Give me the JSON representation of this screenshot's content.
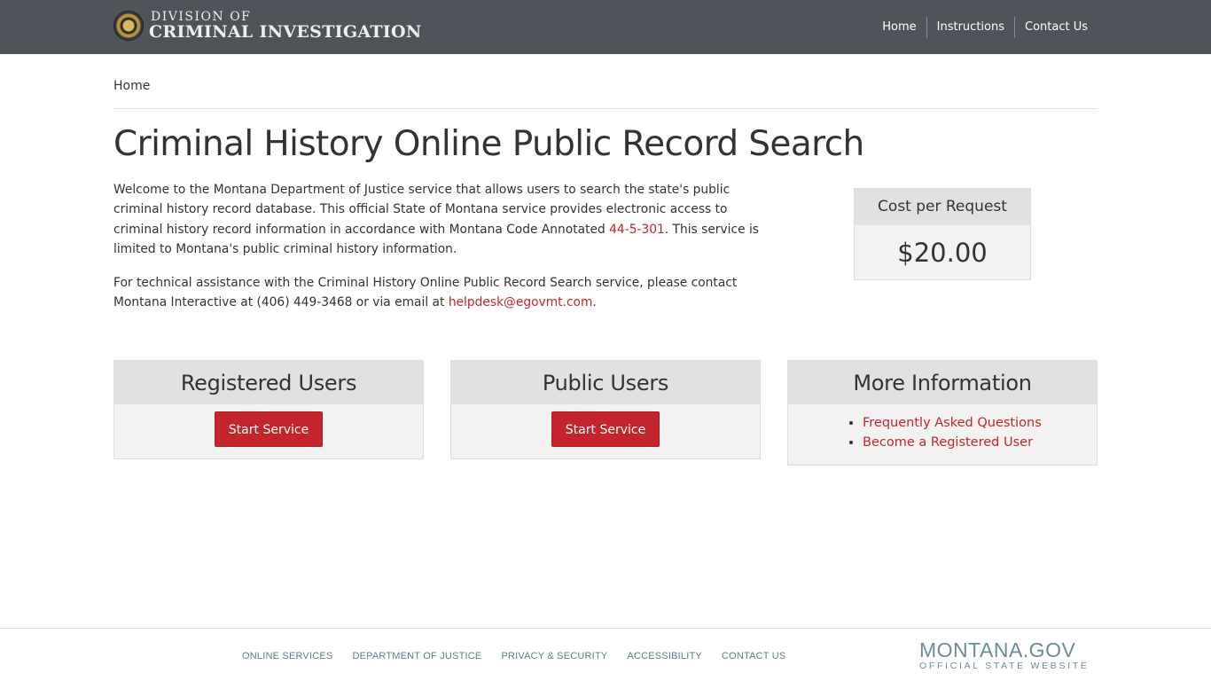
{
  "header": {
    "brand_line1": "DIVISION OF",
    "brand_line2": "CRIMINAL INVESTIGATION",
    "nav": [
      "Home",
      "Instructions",
      "Contact Us"
    ]
  },
  "breadcrumb": "Home",
  "page_title": "Criminal History Online Public Record Search",
  "intro": {
    "p1_a": "Welcome to the Montana Department of Justice service that allows users to search the state's public criminal history record database. This official State of Montana service provides electronic access to criminal history record information in accordance with Montana Code Annotated ",
    "p1_link": "44-5-301",
    "p1_b": ". This service is limited to Montana's public criminal history information.",
    "p2_a": "For technical assistance with the Criminal History Online Public Record Search service, please contact Montana Interactive at (406) 449-3468 or via email at ",
    "p2_link": "helpdesk@egovmt.com",
    "p2_b": "."
  },
  "cost": {
    "label": "Cost per Request",
    "value": "$20.00"
  },
  "panels": {
    "registered": {
      "title": "Registered Users",
      "button": "Start Service"
    },
    "public": {
      "title": "Public Users",
      "button": "Start Service"
    },
    "more": {
      "title": "More Information",
      "links": [
        "Frequently Asked Questions",
        "Become a Registered User"
      ]
    }
  },
  "footer": {
    "links": [
      "ONLINE SERVICES",
      "DEPARTMENT OF JUSTICE",
      "PRIVACY & SECURITY",
      "ACCESSIBILITY",
      "CONTACT US"
    ],
    "logo_main": "MONTANA.GOV",
    "logo_sub": "OFFICIAL STATE WEBSITE"
  },
  "colors": {
    "header_bg": "#4f545a",
    "accent_red": "#c4242c",
    "panel_head": "#e1e1e1",
    "panel_body": "#f2f2f2",
    "footer_text": "#5b7f86"
  }
}
